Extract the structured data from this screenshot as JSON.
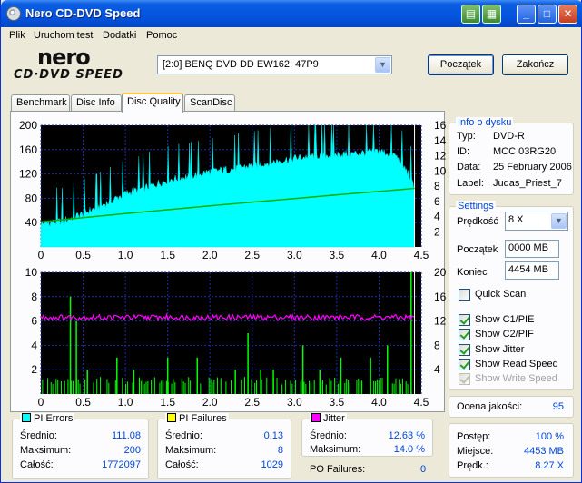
{
  "window": {
    "title": "Nero CD-DVD Speed"
  },
  "menu": [
    "Plik",
    "Uruchom test",
    "Dodatki",
    "Pomoc"
  ],
  "logo": {
    "line1": "nero",
    "line2": "CD·DVD SPEED"
  },
  "drive": {
    "selected": "[2:0]  BENQ DVD DD EW162I 47P9"
  },
  "buttons": {
    "start": "Początek",
    "finish": "Zakończ"
  },
  "tabs": [
    "Benchmark",
    "Disc Info",
    "Disc Quality",
    "ScanDisc"
  ],
  "active_tab": "Disc Quality",
  "disc_info": {
    "title": "Info o dysku",
    "rows": [
      {
        "label": "Typ:",
        "value": "DVD-R"
      },
      {
        "label": "ID:",
        "value": "MCC 03RG20"
      },
      {
        "label": "Data:",
        "value": "25 February 2006"
      },
      {
        "label": "Label:",
        "value": "Judas_Priest_7"
      }
    ]
  },
  "settings": {
    "title": "Settings",
    "speed_label": "Prędkość",
    "speed_value": "8 X",
    "start_label": "Początek",
    "start_value": "0000 MB",
    "end_label": "Koniec",
    "end_value": "4454 MB",
    "quick_scan": {
      "label": "Quick Scan",
      "checked": false
    },
    "options": [
      {
        "label": "Show C1/PIE",
        "checked": true,
        "enabled": true
      },
      {
        "label": "Show C2/PIF",
        "checked": true,
        "enabled": true
      },
      {
        "label": "Show Jitter",
        "checked": true,
        "enabled": true
      },
      {
        "label": "Show Read Speed",
        "checked": true,
        "enabled": true
      },
      {
        "label": "Show Write Speed",
        "checked": true,
        "enabled": false
      }
    ]
  },
  "quality": {
    "label": "Ocena jakości:",
    "value": "95"
  },
  "progress": {
    "rows": [
      {
        "label": "Postęp:",
        "value": "100 %"
      },
      {
        "label": "Miejsce:",
        "value": "4453 MB"
      },
      {
        "label": "Prędk.:",
        "value": "8.27 X"
      }
    ]
  },
  "pi_errors": {
    "title": "PI Errors",
    "color": "#00ffff",
    "rows": [
      {
        "label": "Średnio:",
        "value": "111.08"
      },
      {
        "label": "Maksimum:",
        "value": "200"
      },
      {
        "label": "Całość:",
        "value": "1772097"
      }
    ]
  },
  "pi_failures": {
    "title": "PI Failures",
    "color": "#ffff00",
    "rows": [
      {
        "label": "Średnio:",
        "value": "0.13"
      },
      {
        "label": "Maksimum:",
        "value": "8"
      },
      {
        "label": "Całość:",
        "value": "1029"
      }
    ]
  },
  "jitter": {
    "title": "Jitter",
    "color": "#ff00ff",
    "rows": [
      {
        "label": "Średnio:",
        "value": "12.63 %"
      },
      {
        "label": "Maksimum:",
        "value": "14.0 %"
      }
    ]
  },
  "po_failures": {
    "label": "PO Failures:",
    "value": "0"
  },
  "chart_data": [
    {
      "type": "area",
      "x_ticks": [
        "0",
        "0.5",
        "1.0",
        "1.5",
        "2.0",
        "2.5",
        "3.0",
        "3.5",
        "4.0",
        "4.5"
      ],
      "xlim": [
        0,
        4.5
      ],
      "y_left_ticks": [
        "40",
        "80",
        "120",
        "160",
        "200"
      ],
      "ylim_left": [
        0,
        200
      ],
      "y_right_ticks": [
        "2",
        "4",
        "6",
        "8",
        "10",
        "12",
        "14",
        "16"
      ],
      "ylim_right": [
        0,
        16
      ],
      "pi_errors_envelope": {
        "x": [
          0,
          0.25,
          0.5,
          0.75,
          1.0,
          1.25,
          1.5,
          1.75,
          2.0,
          2.25,
          2.5,
          2.75,
          3.0,
          3.25,
          3.5,
          3.75,
          4.0,
          4.2,
          4.35,
          4.42
        ],
        "y": [
          38,
          42,
          55,
          70,
          88,
          98,
          110,
          116,
          124,
          128,
          134,
          140,
          146,
          150,
          152,
          154,
          158,
          150,
          120,
          95
        ]
      },
      "read_speed": {
        "x": [
          0,
          0.5,
          1.0,
          1.5,
          2.0,
          2.5,
          3.0,
          3.5,
          4.0,
          4.42
        ],
        "y": [
          3.3,
          3.85,
          4.4,
          4.9,
          5.4,
          5.9,
          6.35,
          6.85,
          7.3,
          7.7
        ]
      },
      "grid": true
    },
    {
      "type": "bar",
      "x_ticks": [
        "0",
        "0.5",
        "1.0",
        "1.5",
        "2.0",
        "2.5",
        "3.0",
        "3.5",
        "4.0",
        "4.5"
      ],
      "xlim": [
        0,
        4.5
      ],
      "y_left_ticks": [
        "2",
        "4",
        "6",
        "8",
        "10"
      ],
      "ylim_left": [
        0,
        10
      ],
      "y_right_ticks": [
        "4",
        "8",
        "12",
        "16",
        "20"
      ],
      "ylim_right": [
        0,
        20
      ],
      "pi_failures_spikes": {
        "x": [
          0.35,
          0.42,
          0.55,
          0.9,
          1.1,
          1.5,
          1.85,
          2.3,
          2.45,
          2.6,
          2.75,
          3.1,
          3.3,
          3.55,
          3.9,
          4.1,
          4.38
        ],
        "y": [
          8,
          6,
          2,
          3,
          2,
          3,
          3,
          2,
          5,
          2,
          2,
          4,
          2,
          3,
          3,
          4,
          10
        ]
      },
      "jitter_level": 12.6,
      "grid": true
    }
  ]
}
